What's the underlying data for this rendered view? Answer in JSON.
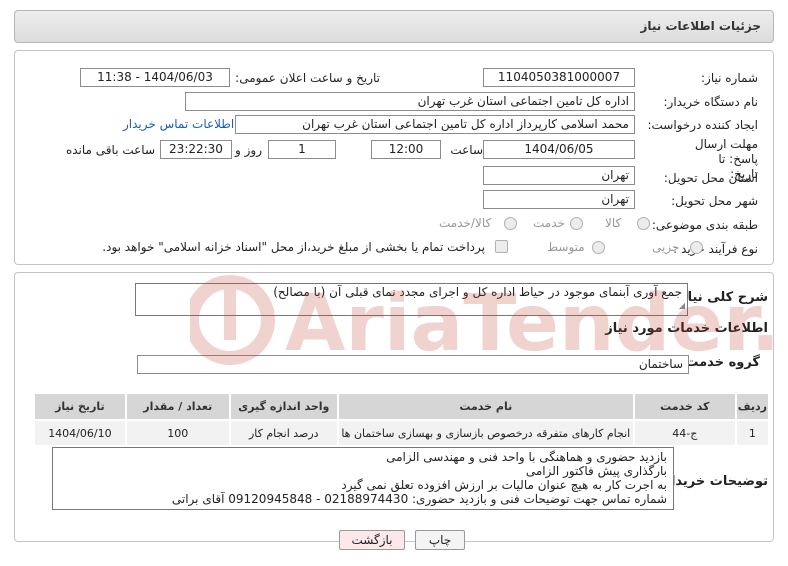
{
  "header": {
    "title": "جزئیات اطلاعات نیاز"
  },
  "fields": {
    "need_number_label": "شماره نیاز:",
    "need_number": "1104050381000007",
    "announce_label": "تاریخ و ساعت اعلان عمومی:",
    "announce_value": "1404/06/03 - 11:38",
    "buyer_org_label": "نام دستگاه خریدار:",
    "buyer_org": "اداره کل تامین اجتماعی استان غرب تهران",
    "creator_label": "ایجاد کننده درخواست:",
    "creator": "محمد اسلامی کارپرداز اداره کل تامین اجتماعی استان غرب تهران",
    "contact_link": "اطلاعات تماس خریدار",
    "deadline_label": "مهلت ارسال پاسخ: تا تاریخ:",
    "deadline_date": "1404/06/05",
    "time_label": "ساعت",
    "deadline_time": "12:00",
    "days_value": "1",
    "days_label": "روز و",
    "remaining_time": "23:22:30",
    "remaining_label": "ساعت باقی مانده",
    "province_label": "استان محل تحویل:",
    "province": "تهران",
    "city_label": "شهر محل تحویل:",
    "city": "تهران",
    "category_label": "طبقه بندی موضوعی:",
    "category_options": [
      "کالا",
      "خدمت",
      "کالا/خدمت"
    ],
    "process_label": "نوع فرآیند خرید :",
    "process_options": [
      "جزیی",
      "متوسط"
    ],
    "payment_note": "پرداخت تمام یا بخشی از مبلغ خرید،از محل \"اسناد خزانه اسلامی\" خواهد بود."
  },
  "summary": {
    "label": "شرح کلی نیاز:",
    "text": "جمع آوری آبنمای موجود در حیاط اداره کل و اجرای مجدد نمای قبلی آن (با مصالح)"
  },
  "services": {
    "section_title": "اطلاعات خدمات مورد نیاز",
    "group_label": "گروه خدمت:",
    "group_value": "ساختمان",
    "columns": [
      "ردیف",
      "کد خدمت",
      "نام خدمت",
      "واحد اندازه گیری",
      "تعداد / مقدار",
      "تاریخ نیاز"
    ],
    "rows": [
      [
        "1",
        "ج-44",
        "انجام کارهای متفرقه درخصوص بازسازی و بهسازی ساختمان ها",
        "درصد انجام کار",
        "100",
        "1404/06/10"
      ]
    ]
  },
  "notes": {
    "label": "توضیحات خریدار:",
    "lines": [
      "بازدید حضوری و هماهنگی با واحد فنی و مهندسی الزامی",
      "بارگذاری پیش فاکتور الزامی",
      "به اجرت کار به هیچ عنوان مالیات بر ارزش افزوده تعلق نمی گیرد",
      "شماره تماس جهت توضیحات فنی و بازدید حضوری:  02188974430   -  09120945848  آقای براتی"
    ]
  },
  "buttons": {
    "print": "چاپ",
    "back": "بازگشت"
  },
  "watermark": {
    "text": "AriaTender.neT"
  },
  "colors": {
    "link": "#1a5fb4",
    "watermark": "#c0392b",
    "back_button_bg": "#fde8ec"
  }
}
